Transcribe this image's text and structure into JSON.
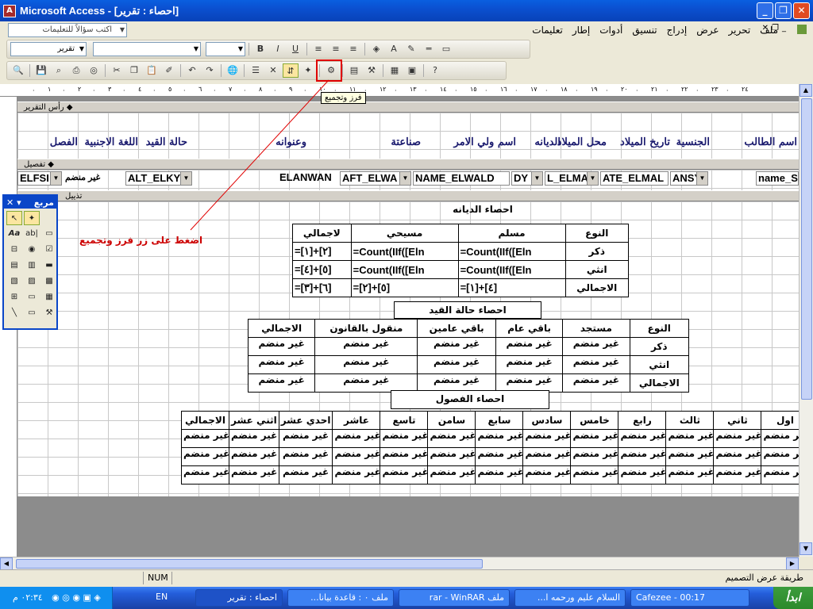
{
  "window": {
    "title": "Microsoft Access - [احصاء : تقرير]"
  },
  "menu": [
    "ملف",
    "تحرير",
    "عرض",
    "إدراج",
    "تنسيق",
    "أدوات",
    "إطار",
    "تعليمات"
  ],
  "question_box": "اكتب سؤالاً للتعليمات",
  "toolbar": {
    "object_combo": "تقرير"
  },
  "tooltip": "فرز وتجميع",
  "annotation": "اضغط على زر فرز وتجميع",
  "sections": {
    "report_header": "رأس التقرير",
    "detail": "تفصيل",
    "footer": "تذييل"
  },
  "header_labels": [
    "اسم الطالب",
    "الجنسية",
    "تاريخ الميلاد",
    "محل الميلاد",
    "الديانه",
    "اسم ولي الامر",
    "صناعتة",
    "وعنوانه",
    "حالة القيد",
    "اللغة الاجنبية",
    "الفصل"
  ],
  "detail_fields": [
    "name_S",
    "ANSY",
    "ATE_ELMAL",
    "L_ELMA",
    "DY",
    "NAME_ELWALD",
    "AFT_ELWA",
    "ELANWAN",
    "ALT_ELKY",
    "غير منضم",
    "ELFSI"
  ],
  "religion": {
    "title": "احصاء الديانه",
    "headers": [
      "النوع",
      "مسلم",
      "مسيحي",
      "لاجمالي"
    ],
    "rows": [
      [
        "ذكر",
        "=Count(IIf([Eln",
        "=Count(IIf([Eln",
        "=[١]+[٢]"
      ],
      [
        "انثي",
        "=Count(IIf([Eln",
        "=Count(IIf([Eln",
        "=[٤]+[٥]"
      ],
      [
        "الاجمالي",
        "=[١]+[٤]",
        "=[٢]+[٥]",
        "=[٣]+[٦]"
      ]
    ]
  },
  "status": {
    "title": "احصاء حالة القيد",
    "headers": [
      "النوع",
      "مستجد",
      "باقي عام",
      "باقي عامين",
      "منقول بالقانون",
      "الاجمالي"
    ],
    "rows": [
      [
        "ذكر"
      ],
      [
        "انثي"
      ],
      [
        "الاجمالي"
      ]
    ],
    "cell": "غير منضم"
  },
  "classes": {
    "title": "احصاء الفصول",
    "headers": [
      "النوع",
      "اول",
      "ثاني",
      "ثالث",
      "رابع",
      "خامس",
      "سادس",
      "سابع",
      "سامن",
      "تاسع",
      "عاشر",
      "احدي عشر",
      "اثني عشر",
      "الاجمالي"
    ],
    "rows": [
      [
        "ذكر"
      ],
      [
        "انثي"
      ],
      [
        "لاجمالي"
      ]
    ],
    "cell": "غير منضم",
    "cell_short": "غير منضم"
  },
  "toolbox": {
    "title": "مربع"
  },
  "statusbar": {
    "mode": "طريقة عرض التصميم",
    "num": "NUM"
  },
  "taskbar": {
    "start": "ابدأ",
    "items": [
      "Cafezee - 00:17",
      "السلام عليم ورحمه ا...",
      "ملف rar - WinRAR",
      "ملف ٠ : قاعدة بيانا...",
      "احصاء : تقرير"
    ],
    "lang": "EN",
    "clock": "٠٢:٣٤ م"
  },
  "ruler": [
    "١",
    "٢",
    "٣",
    "٤",
    "٥",
    "٦",
    "٧",
    "٨",
    "٩",
    "١٠",
    "١١",
    "١٢",
    "١٣",
    "١٤",
    "١٥",
    "١٦",
    "١٧",
    "١٨",
    "١٩",
    "٢٠",
    "٢١",
    "٢٢",
    "٢٣",
    "٢٤"
  ]
}
